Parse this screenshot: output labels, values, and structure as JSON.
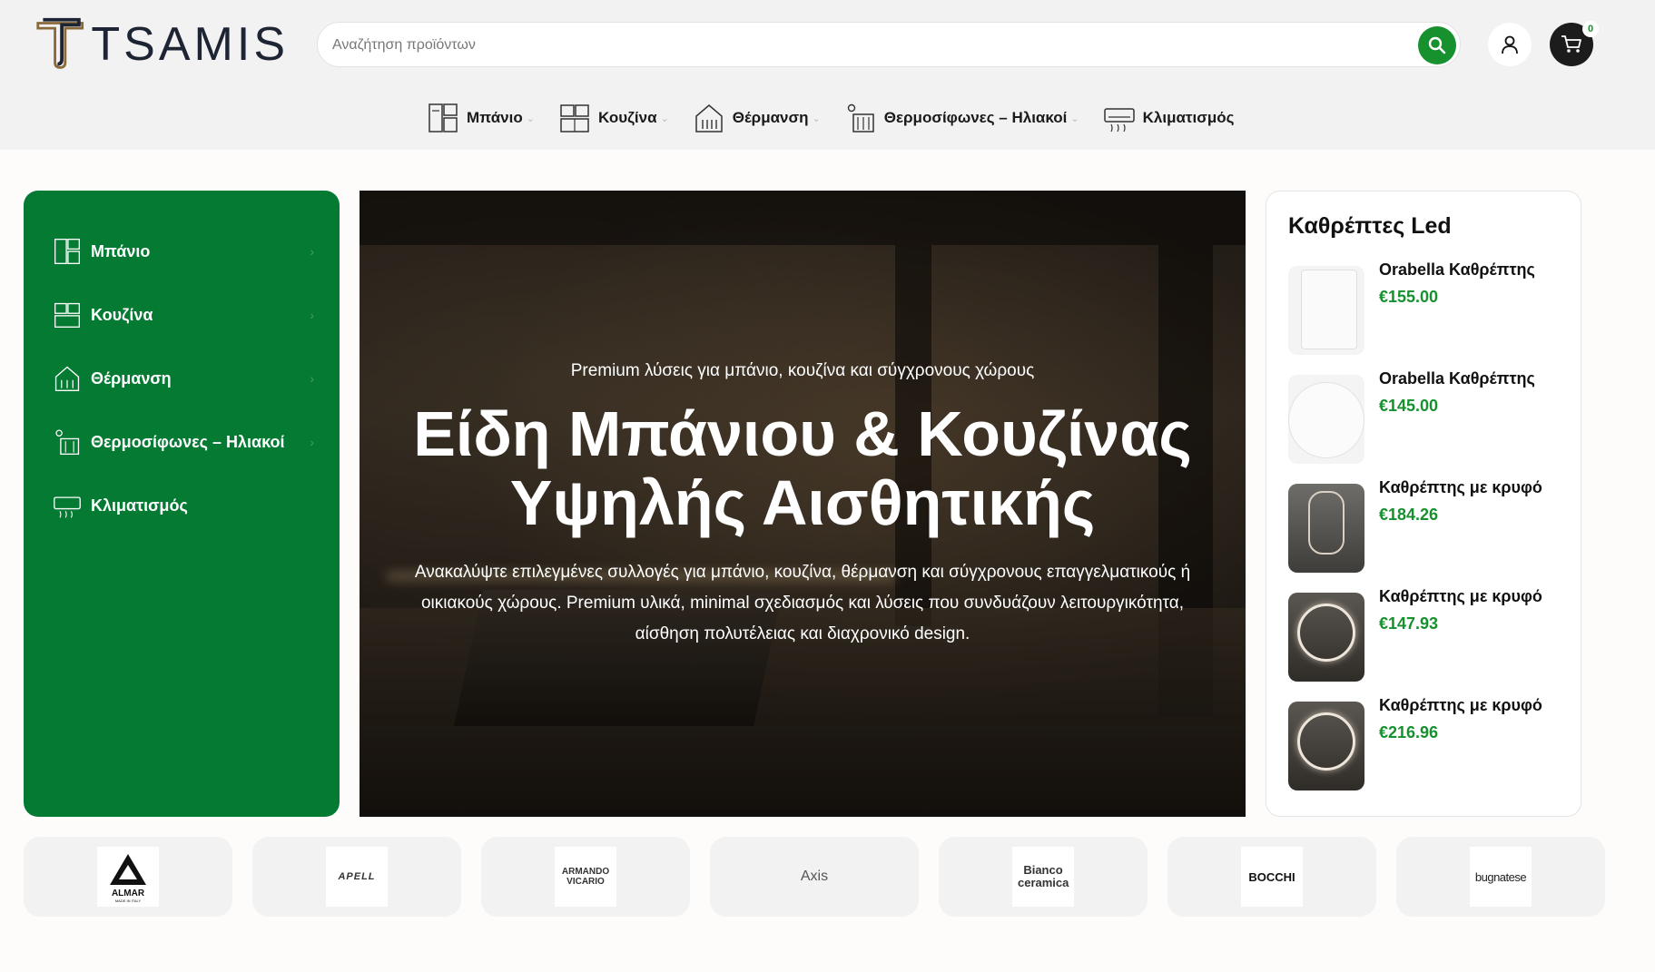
{
  "header": {
    "logo_text": "TSAMIS",
    "search_placeholder": "Αναζήτηση προϊόντων",
    "cart_count": "0"
  },
  "topnav": [
    {
      "label": "Μπάνιο",
      "icon": "bathroom-icon"
    },
    {
      "label": "Κουζίνα",
      "icon": "kitchen-icon"
    },
    {
      "label": "Θέρμανση",
      "icon": "heating-icon"
    },
    {
      "label": "Θερμοσίφωνες – Ηλιακοί",
      "icon": "water-heater-icon"
    },
    {
      "label": "Κλιματισμός",
      "icon": "air-conditioner-icon"
    }
  ],
  "sidebar": [
    {
      "label": "Μπάνιο",
      "icon": "bathroom-icon"
    },
    {
      "label": "Κουζίνα",
      "icon": "kitchen-icon"
    },
    {
      "label": "Θέρμανση",
      "icon": "heating-icon"
    },
    {
      "label": "Θερμοσίφωνες – Ηλιακοί",
      "icon": "water-heater-icon"
    },
    {
      "label": "Κλιματισμός",
      "icon": "air-conditioner-icon"
    }
  ],
  "hero": {
    "subtitle": "Premium λύσεις για μπάνιο, κουζίνα και σύγχρονους χώρους",
    "title_line1": "Είδη Μπάνιου & Κουζίνας",
    "title_line2": "Υψηλής Αισθητικής",
    "description": "Ανακαλύψτε επιλεγμένες συλλογές για μπάνιο, κουζίνα, θέρμανση και σύγχρονους επαγγελματικούς ή οικιακούς χώρους. Premium υλικά, minimal σχεδιασμός και λύσεις που συνδυάζουν λειτουργικότητα, αίσθηση πολυτέλειας και διαχρονικό design."
  },
  "panel": {
    "title": "Καθρέπτες Led",
    "products": [
      {
        "name": "Orabella Καθρέπτης",
        "price": "€155.00"
      },
      {
        "name": "Orabella Καθρέπτης",
        "price": "€145.00"
      },
      {
        "name": "Καθρέπτης με κρυφό",
        "price": "€184.26"
      },
      {
        "name": "Καθρέπτης με κρυφό",
        "price": "€147.93"
      },
      {
        "name": "Καθρέπτης με κρυφό",
        "price": "€216.96"
      }
    ]
  },
  "brands": [
    {
      "name": "ALMAR",
      "sub": "MADE IN ITALY"
    },
    {
      "name": "APELL"
    },
    {
      "name": "ARMANDO VICARIO"
    },
    {
      "name": "Axis"
    },
    {
      "name": "Bianco ceramica"
    },
    {
      "name": "BOCCHI"
    },
    {
      "name": "bugnatese"
    }
  ],
  "colors": {
    "brand_green": "#16912e",
    "sidebar_green": "#047a33",
    "header_bg": "#f2f2f2"
  }
}
